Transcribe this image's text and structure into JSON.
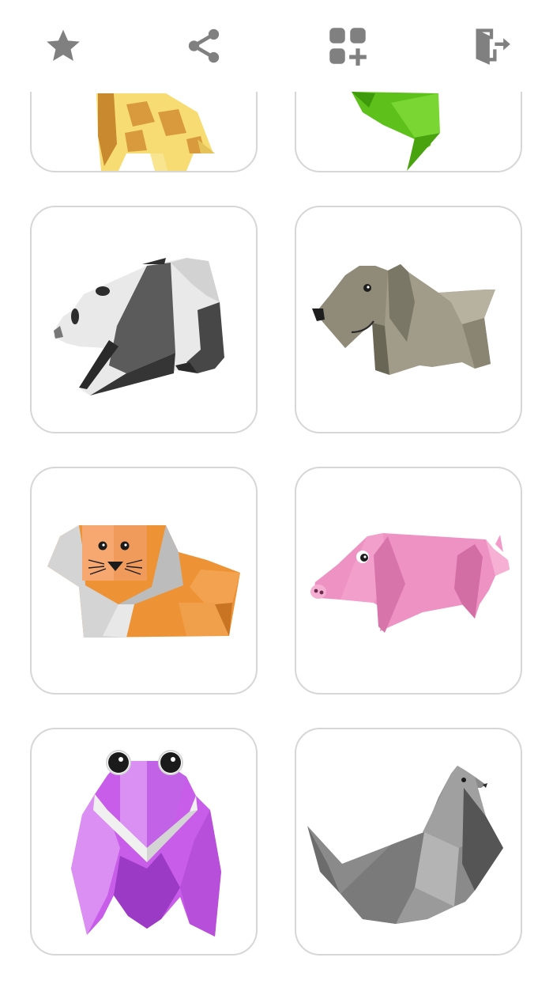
{
  "toolbar": {
    "buttons": [
      {
        "icon": "star-icon",
        "color": "#808080"
      },
      {
        "icon": "share-icon",
        "color": "#808080"
      },
      {
        "icon": "add-grid-icon",
        "color": "#808080"
      },
      {
        "icon": "exit-icon",
        "color": "#808080"
      }
    ]
  },
  "grid": {
    "card_border_color": "#d6d6d6",
    "cards": [
      {
        "animal": "giraffe"
      },
      {
        "animal": "frog"
      },
      {
        "animal": "panda"
      },
      {
        "animal": "dog"
      },
      {
        "animal": "lion"
      },
      {
        "animal": "pig"
      },
      {
        "animal": "cicada"
      },
      {
        "animal": "seal"
      }
    ]
  }
}
